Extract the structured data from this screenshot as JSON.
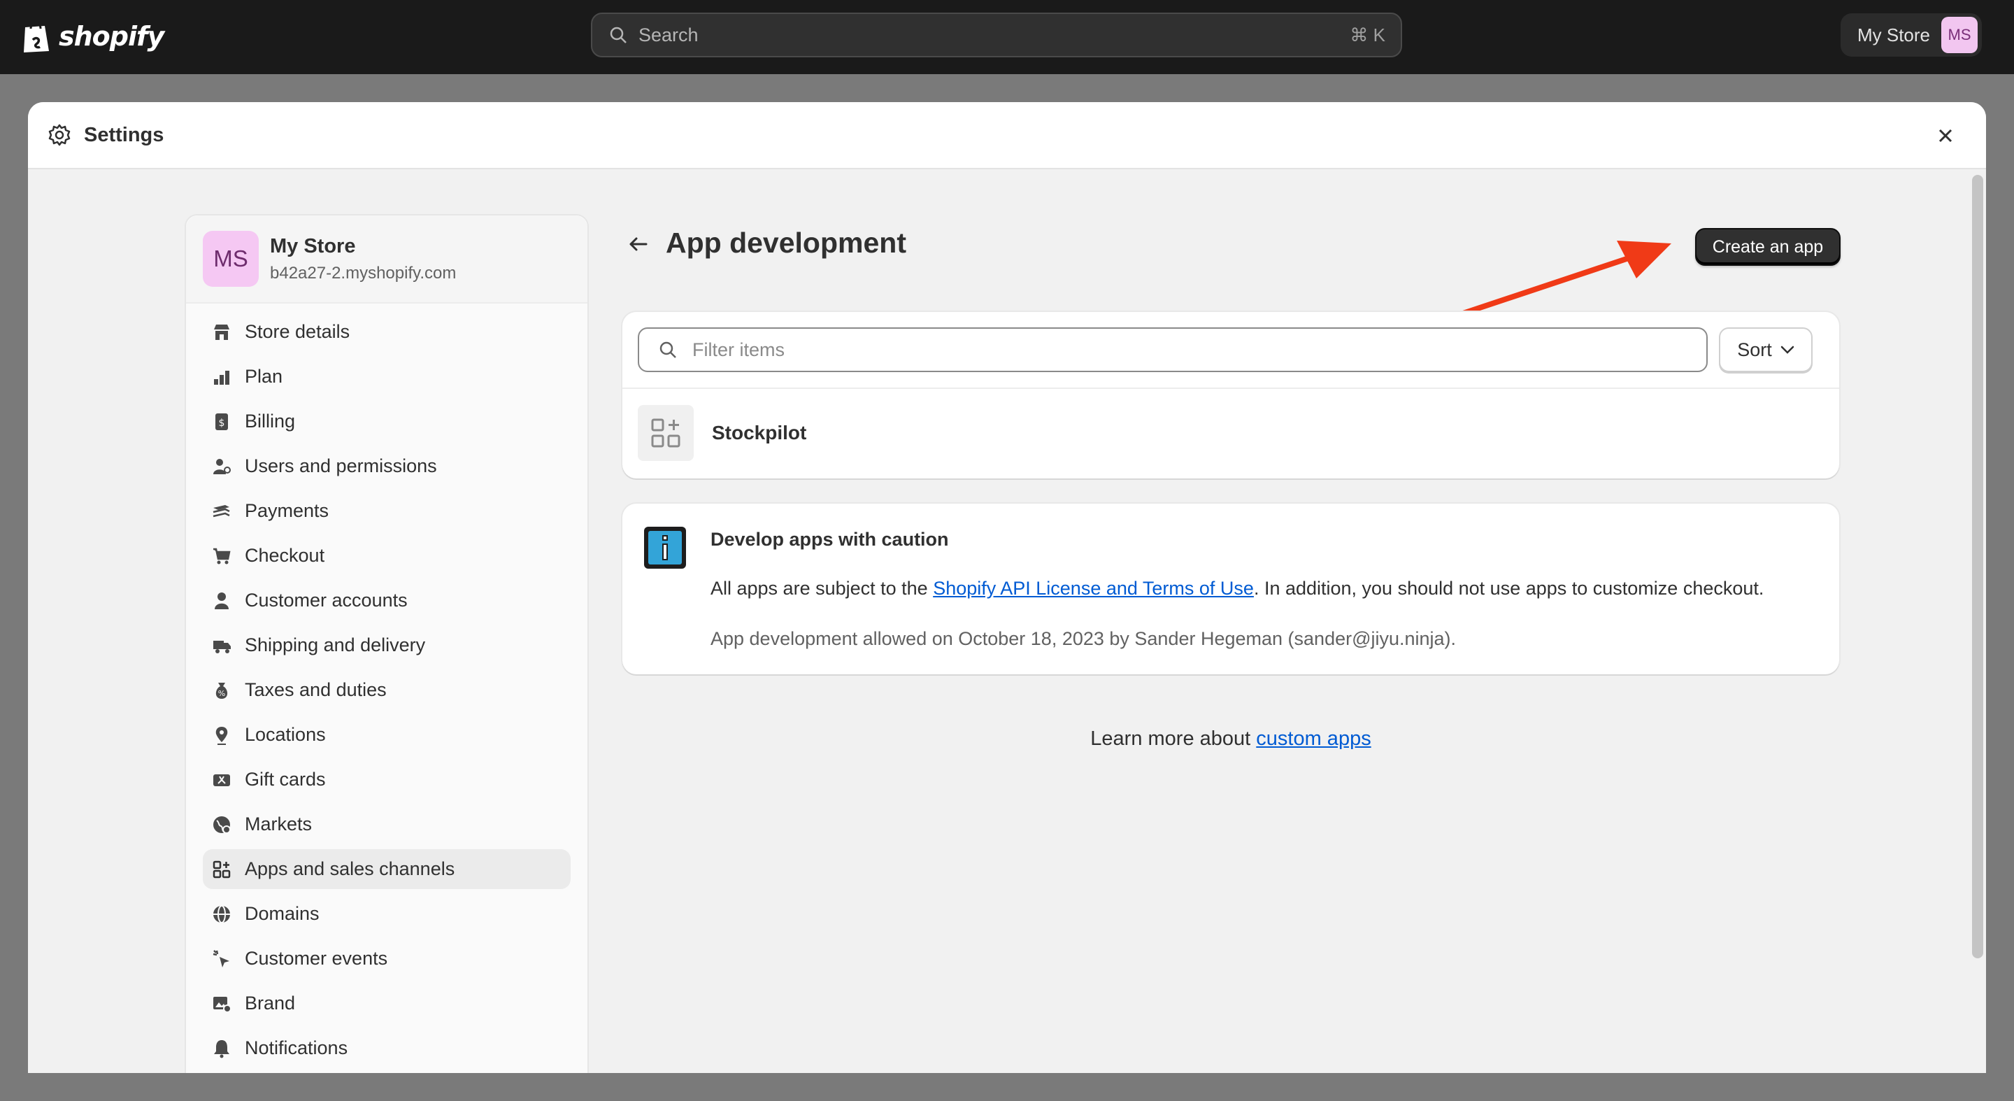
{
  "topbar": {
    "brand": "shopify",
    "search_label": "Search",
    "search_shortcut": "⌘ K",
    "store_button_label": "My Store",
    "avatar_initials": "MS"
  },
  "modal": {
    "title": "Settings"
  },
  "sidebar": {
    "store": {
      "initials": "MS",
      "name": "My Store",
      "domain": "b42a27-2.myshopify.com"
    },
    "items": [
      {
        "label": "Store details",
        "icon": "store-icon"
      },
      {
        "label": "Plan",
        "icon": "plan-icon"
      },
      {
        "label": "Billing",
        "icon": "billing-icon"
      },
      {
        "label": "Users and permissions",
        "icon": "users-icon"
      },
      {
        "label": "Payments",
        "icon": "payments-icon"
      },
      {
        "label": "Checkout",
        "icon": "cart-icon"
      },
      {
        "label": "Customer accounts",
        "icon": "person-icon"
      },
      {
        "label": "Shipping and delivery",
        "icon": "truck-icon"
      },
      {
        "label": "Taxes and duties",
        "icon": "tax-icon"
      },
      {
        "label": "Locations",
        "icon": "location-icon"
      },
      {
        "label": "Gift cards",
        "icon": "gift-card-icon"
      },
      {
        "label": "Markets",
        "icon": "globe-icon"
      },
      {
        "label": "Apps and sales channels",
        "icon": "apps-icon",
        "active": true
      },
      {
        "label": "Domains",
        "icon": "domains-icon"
      },
      {
        "label": "Customer events",
        "icon": "events-icon"
      },
      {
        "label": "Brand",
        "icon": "brand-icon"
      },
      {
        "label": "Notifications",
        "icon": "bell-icon"
      }
    ]
  },
  "main": {
    "title": "App development",
    "create_button": "Create an app",
    "filter_placeholder": "Filter items",
    "sort_label": "Sort",
    "apps": [
      {
        "name": "Stockpilot"
      }
    ],
    "caution": {
      "title": "Develop apps with caution",
      "body_prefix": "All apps are subject to the ",
      "body_link": "Shopify API License and Terms of Use",
      "body_suffix": ". In addition, you should not use apps to customize checkout.",
      "meta": "App development allowed on October 18, 2023 by Sander Hegeman (sander@jiyu.ninja)."
    },
    "learn_more": {
      "prefix": "Learn more about ",
      "link": "custom apps"
    }
  },
  "colors": {
    "topbar": "#1a1a1a",
    "primary_button": "#303030",
    "link": "#005bd3",
    "annotation_arrow": "#f03a17",
    "avatar": "#f5c8f3"
  }
}
